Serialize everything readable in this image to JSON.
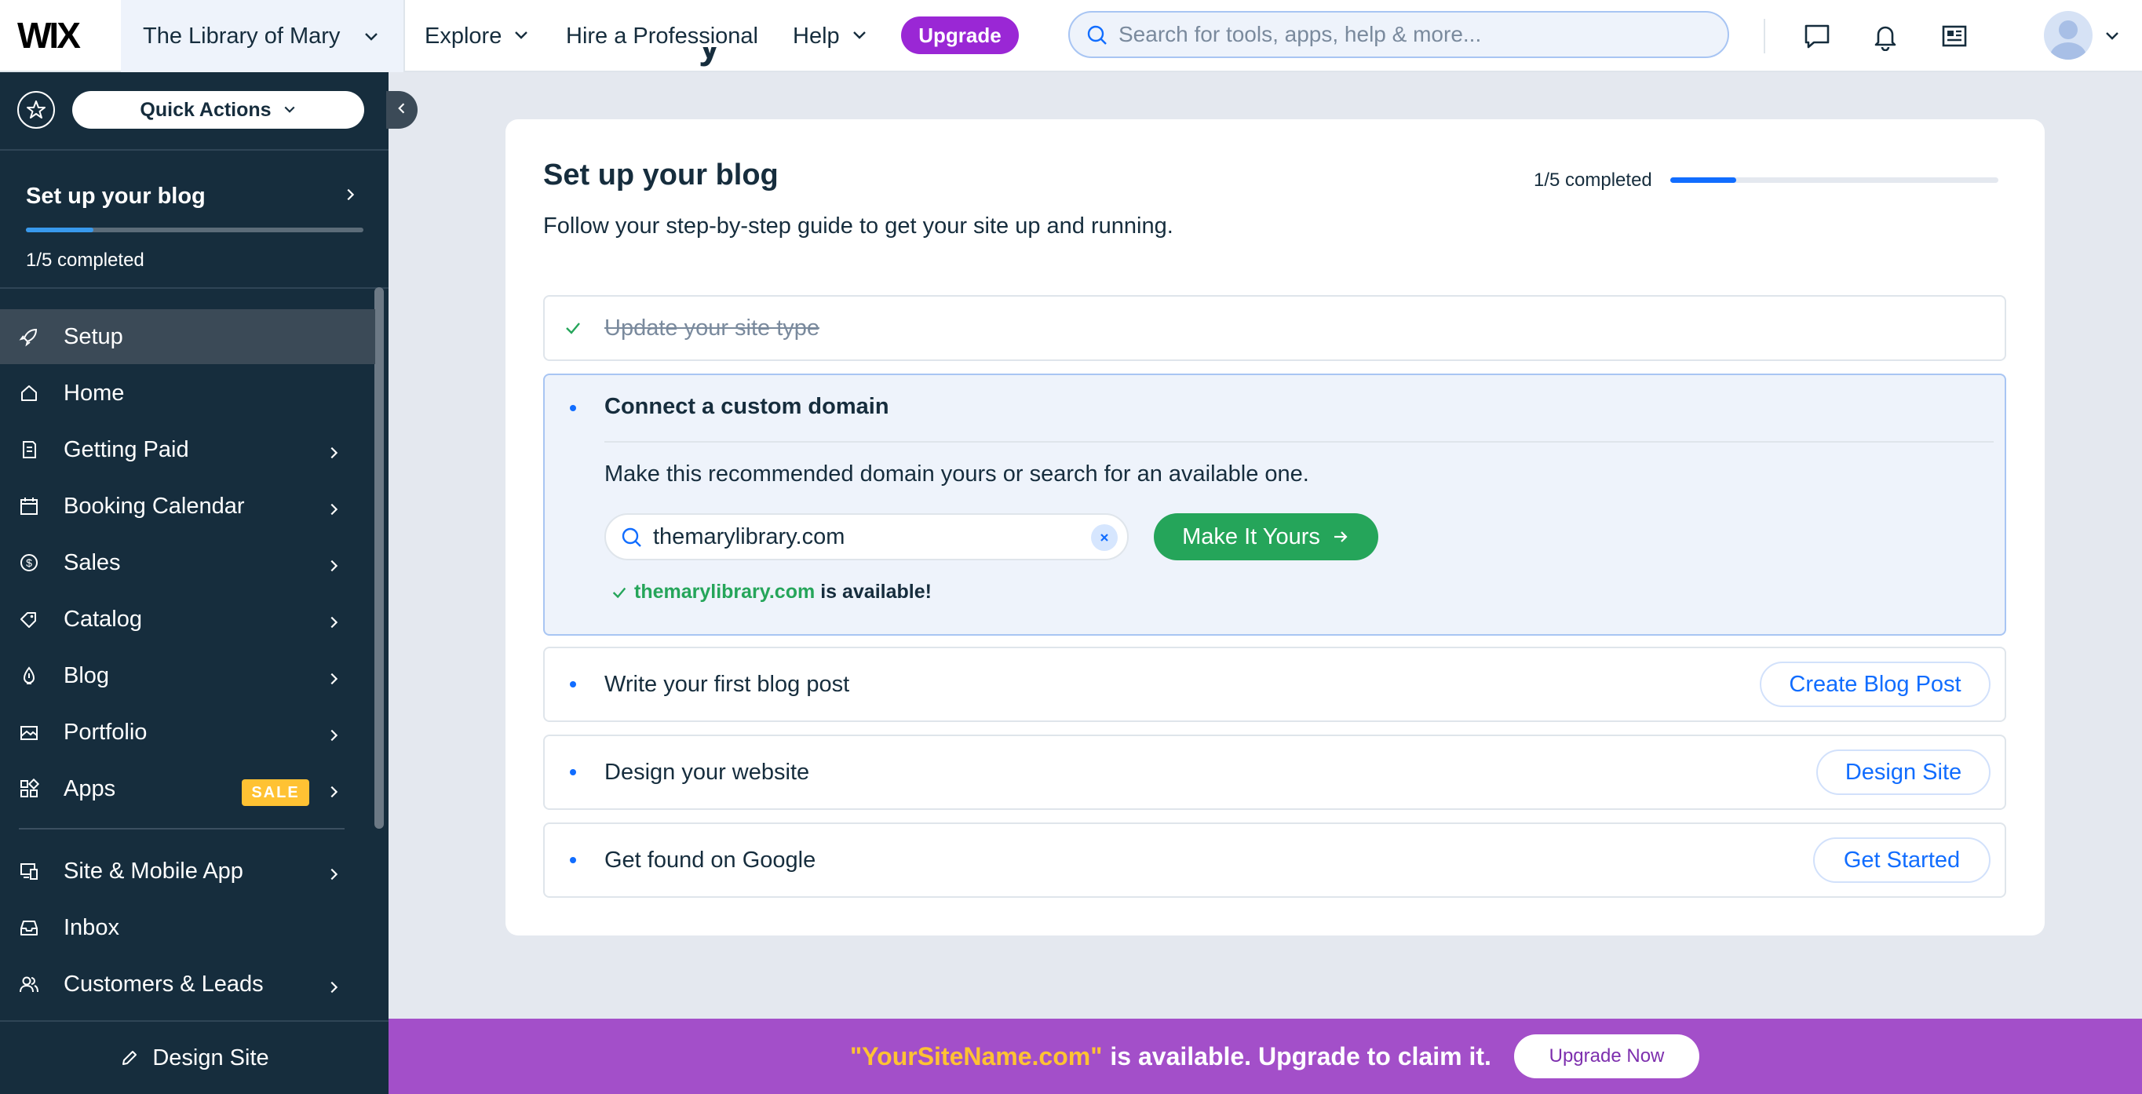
{
  "topbar": {
    "logo": "WIX",
    "site_name": "The Library of Mary",
    "nav": {
      "explore": "Explore",
      "hire": "Hire a Professional",
      "help": "Help"
    },
    "upgrade_label": "Upgrade",
    "search_placeholder": "Search for tools, apps, help & more...",
    "icons": [
      "chat-icon",
      "bell-icon",
      "news-icon",
      "avatar-icon"
    ]
  },
  "sidebar": {
    "quick_actions": "Quick Actions",
    "setup_title": "Set up your blog",
    "setup_progress_fraction": 0.2,
    "setup_completed": "1/5 completed",
    "items": [
      {
        "label": "Setup",
        "icon": "rocket-icon",
        "chevron": false,
        "active": true
      },
      {
        "label": "Home",
        "icon": "home-icon",
        "chevron": false
      },
      {
        "label": "Getting Paid",
        "icon": "receipt-icon",
        "chevron": true
      },
      {
        "label": "Booking Calendar",
        "icon": "calendar-icon",
        "chevron": true
      },
      {
        "label": "Sales",
        "icon": "dollar-icon",
        "chevron": true
      },
      {
        "label": "Catalog",
        "icon": "tag-icon",
        "chevron": true
      },
      {
        "label": "Blog",
        "icon": "pen-nib-icon",
        "chevron": true
      },
      {
        "label": "Portfolio",
        "icon": "portfolio-icon",
        "chevron": true
      },
      {
        "label": "Apps",
        "icon": "apps-icon",
        "chevron": true,
        "badge": "SALE"
      },
      {
        "label": "Site & Mobile App",
        "icon": "devices-icon",
        "chevron": true
      },
      {
        "label": "Inbox",
        "icon": "inbox-icon",
        "chevron": false
      },
      {
        "label": "Customers & Leads",
        "icon": "customers-icon",
        "chevron": true
      }
    ],
    "design_site": "Design Site"
  },
  "main": {
    "header_peek": "y",
    "title": "Set up your blog",
    "subtitle": "Follow your step-by-step guide to get your site up and running.",
    "completed": "1/5 completed",
    "progress_fraction": 0.2,
    "steps": {
      "update_site_type": "Update your site type",
      "connect_domain": {
        "label": "Connect a custom domain",
        "description": "Make this recommended domain yours or search for an available one.",
        "input_value": "themarylibrary.com",
        "button": "Make It Yours",
        "available_domain": "themarylibrary.com",
        "available_suffix": "is available!"
      },
      "blog_post": {
        "label": "Write your first blog post",
        "button": "Create Blog Post"
      },
      "design": {
        "label": "Design your website",
        "button": "Design Site"
      },
      "google": {
        "label": "Get found on Google",
        "button": "Get Started"
      }
    }
  },
  "banner": {
    "domain": "\"YourSiteName.com\"",
    "text": "is available. Upgrade to claim it.",
    "button": "Upgrade Now"
  },
  "colors": {
    "sidebar_bg": "#162d3d",
    "accent_blue": "#116dff",
    "upgrade_purple": "#9a27d5",
    "success_green": "#25a55a",
    "banner_purple": "#a34fc9",
    "sale_yellow": "#ffc233"
  }
}
